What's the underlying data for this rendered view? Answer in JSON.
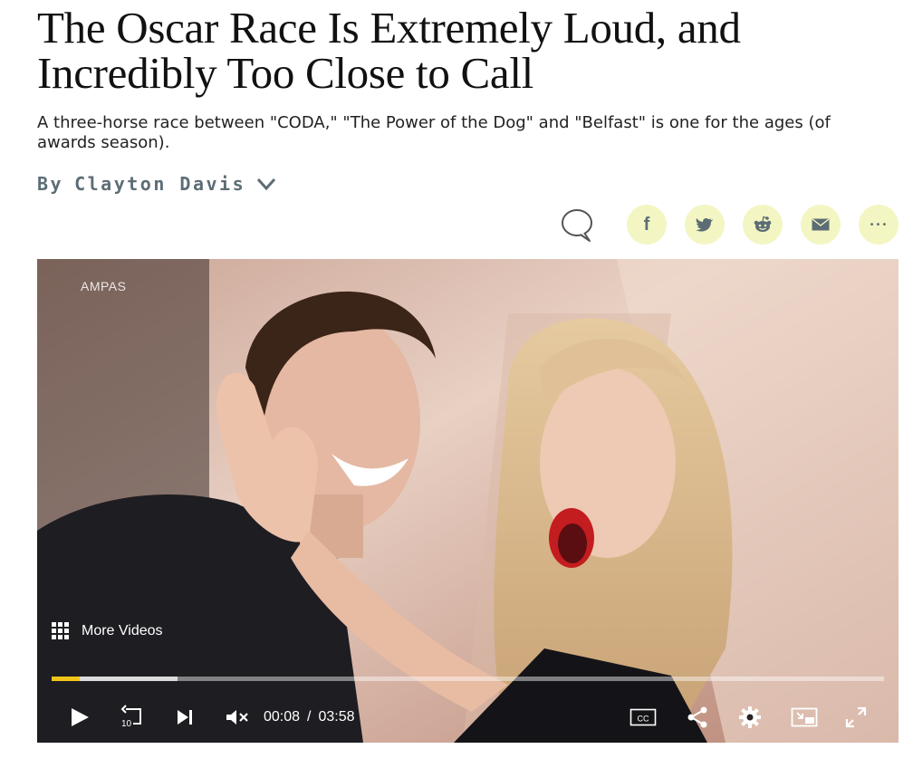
{
  "article": {
    "headline": "The Oscar Race Is Extremely Loud, and Incredibly Too Close to Call",
    "dek": "A three-horse race between \"CODA,\" \"The Power of the Dog\" and \"Belfast\" is one for the ages (of awards season).",
    "byline_prefix": "By",
    "author": "Clayton Davis"
  },
  "share": {
    "icons": [
      "comment-icon",
      "facebook-icon",
      "twitter-icon",
      "reddit-icon",
      "email-icon",
      "more-icon"
    ],
    "facebook_glyph": "f",
    "more_glyph": "•••",
    "button_color": "#f3f6c2",
    "icon_color": "#5d6d75"
  },
  "video": {
    "watermark": "AMPAS",
    "more_videos_label": "More Videos",
    "current_time": "00:08",
    "time_separator": "/",
    "duration": "03:58",
    "rewind_label": "10",
    "progress_fraction": 0.034,
    "buffered_fraction": 0.151,
    "progress_color": "#f0c419",
    "cc_label": "CC",
    "muted": true
  }
}
